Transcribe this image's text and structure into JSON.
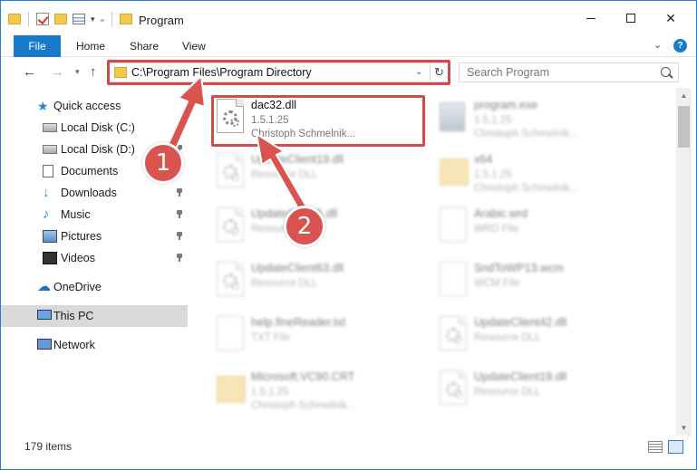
{
  "window": {
    "title": "Program",
    "colors": {
      "accent": "#1979ca",
      "highlight": "#d24a4a"
    }
  },
  "ribbon": {
    "tabs": [
      {
        "label": "File"
      },
      {
        "label": "Home"
      },
      {
        "label": "Share"
      },
      {
        "label": "View"
      }
    ]
  },
  "address": {
    "path": "C:\\Program Files\\Program Directory",
    "search_placeholder": "Search Program"
  },
  "nav": {
    "items": [
      {
        "label": "Quick access",
        "icon": "star-icon"
      },
      {
        "label": "Local Disk (C:)",
        "icon": "disk-icon",
        "pinned": true
      },
      {
        "label": "Local Disk (D:)",
        "icon": "disk-icon",
        "pinned": true
      },
      {
        "label": "Documents",
        "icon": "documents-icon",
        "pinned": true
      },
      {
        "label": "Downloads",
        "icon": "downloads-icon",
        "pinned": true
      },
      {
        "label": "Music",
        "icon": "music-icon",
        "pinned": true
      },
      {
        "label": "Pictures",
        "icon": "pictures-icon",
        "pinned": true
      },
      {
        "label": "Videos",
        "icon": "videos-icon",
        "pinned": true
      },
      {
        "label": "OneDrive",
        "icon": "onedrive-icon"
      },
      {
        "label": "This PC",
        "icon": "pc-icon",
        "selected": true
      },
      {
        "label": "Network",
        "icon": "network-icon"
      }
    ]
  },
  "files": [
    {
      "name": "dac32.dll",
      "line1": "1.5.1.25",
      "line2": "Christoph Schmelnik...",
      "icon": "dll-file-icon"
    },
    {
      "name": "program.exe",
      "line1": "1.5.1.25",
      "line2": "Christoph Schmelnik...",
      "icon": "exe-file-icon"
    },
    {
      "name": "UpdateClient19.dll",
      "line1": "Resource DLL",
      "line2": "",
      "icon": "dll-file-icon"
    },
    {
      "name": "x64",
      "line1": "1.5.1.25",
      "line2": "Christoph Schmelnik...",
      "icon": "folder-icon"
    },
    {
      "name": "UpdateClient5.dll",
      "line1": "Resource DLL",
      "line2": "",
      "icon": "dll-file-icon"
    },
    {
      "name": "Arabic.wrd",
      "line1": "WRD File",
      "line2": "",
      "icon": "plain-file-icon"
    },
    {
      "name": "UpdateClient63.dll",
      "line1": "Resource DLL",
      "line2": "",
      "icon": "dll-file-icon"
    },
    {
      "name": "SndToWP13.wcm",
      "line1": "WCM File",
      "line2": "",
      "icon": "plain-file-icon"
    },
    {
      "name": "help.fineReader.txt",
      "line1": "TXT File",
      "line2": "",
      "icon": "plain-file-icon"
    },
    {
      "name": "UpdateClient42.dll",
      "line1": "Resource DLL",
      "line2": "",
      "icon": "dll-file-icon"
    },
    {
      "name": "Microsoft.VC90.CRT",
      "line1": "1.5.1.25",
      "line2": "Christoph Schmelnik...",
      "icon": "folder-icon"
    },
    {
      "name": "UpdateClient19.dll",
      "line1": "Resource DLL",
      "line2": "",
      "icon": "dll-file-icon"
    }
  ],
  "status": {
    "count": "179 items"
  },
  "callouts": {
    "one": "1",
    "two": "2"
  }
}
